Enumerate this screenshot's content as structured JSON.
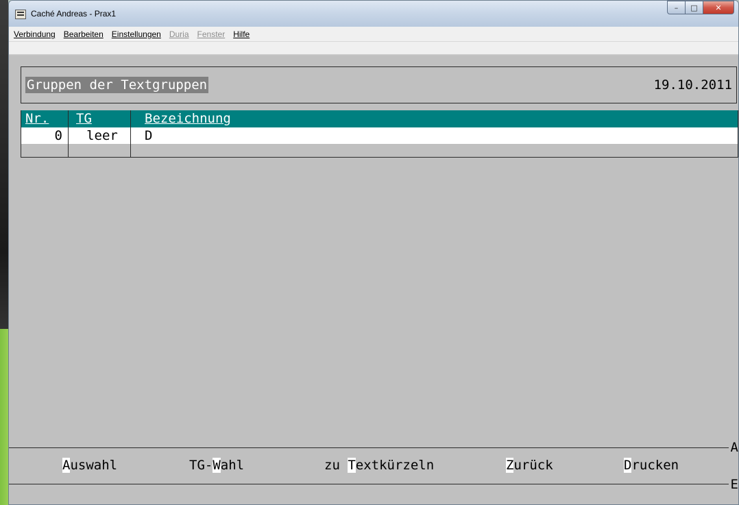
{
  "window": {
    "title": "Caché Andreas - Prax1",
    "buttons": {
      "minimize": "–",
      "maximize": "□",
      "close": "✕"
    }
  },
  "menu": [
    {
      "label": "Verbindung",
      "enabled": true
    },
    {
      "label": "Bearbeiten",
      "enabled": true
    },
    {
      "label": "Einstellungen",
      "enabled": true
    },
    {
      "label": "Duria",
      "enabled": false
    },
    {
      "label": "Fenster",
      "enabled": false
    },
    {
      "label": "Hilfe",
      "enabled": true
    }
  ],
  "header": {
    "title": "Gruppen der Textgruppen",
    "date": "19.10.2011"
  },
  "table": {
    "columns": [
      "Nr.",
      "TG",
      "Bezeichnung"
    ],
    "rows": [
      {
        "nr": "0",
        "tg": "leer",
        "bezeichnung": "D"
      }
    ]
  },
  "function_keys": [
    {
      "hotkey": "A",
      "rest": "uswahl",
      "prefix": ""
    },
    {
      "prefix": "TG-",
      "hotkey": "W",
      "rest": "ahl"
    },
    {
      "prefix": "zu ",
      "hotkey": "T",
      "rest": "extkürzeln"
    },
    {
      "prefix": "",
      "hotkey": "Z",
      "rest": "urück"
    },
    {
      "prefix": "",
      "hotkey": "D",
      "rest": "rucken"
    }
  ],
  "side_markers": {
    "top": "A",
    "bottom": "E"
  },
  "colors": {
    "table_header": "#008080",
    "client_background": "#c0c0c0",
    "title_highlight": "#808080"
  }
}
